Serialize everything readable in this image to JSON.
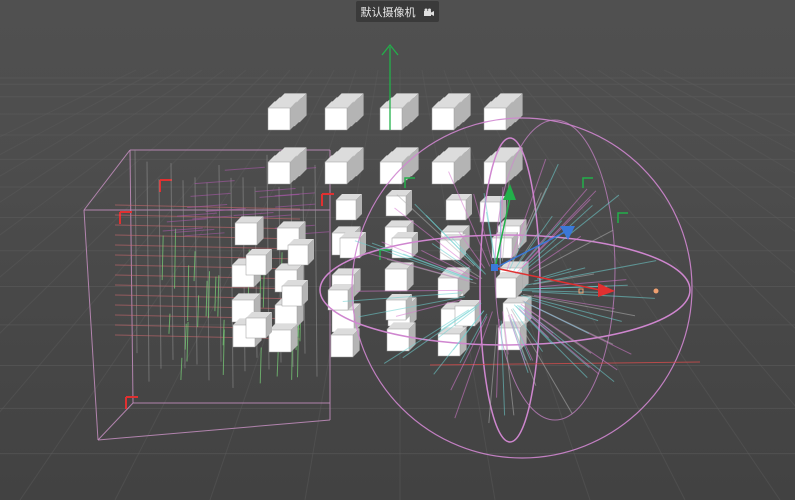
{
  "viewport": {
    "camera_label": "默认摄像机",
    "camera_icon": "camera-icon"
  },
  "colors": {
    "grid": "#5c5c5c",
    "cube_front": "#ffffff",
    "cube_top": "#dcdcdc",
    "cube_side": "#b4b4b4",
    "axis_x": "#e03030",
    "axis_y": "#22b04a",
    "axis_z": "#3a78d8",
    "field_box": "#c58fc0",
    "rotation_gizmo": "#cf86cf"
  }
}
